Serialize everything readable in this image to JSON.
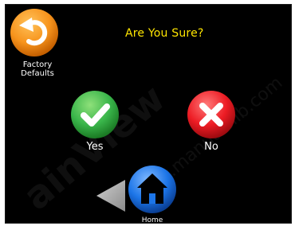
{
  "screen": {
    "title": "Are You Sure?"
  },
  "buttons": {
    "factory_defaults": {
      "label": "Factory Defaults",
      "icon": "undo-arrow-icon",
      "color": "#f7941d"
    },
    "yes": {
      "label": "Yes",
      "icon": "checkmark-icon",
      "color": "#39b54a"
    },
    "no": {
      "label": "No",
      "icon": "x-icon",
      "color": "#ed1c24"
    },
    "back": {
      "icon": "back-triangle-icon",
      "color": "#a6a6a6"
    },
    "home": {
      "label": "Home",
      "icon": "house-icon",
      "color": "#1c75e8"
    }
  },
  "colors": {
    "background": "#000000",
    "title": "#ffe600",
    "label": "#ffffff"
  }
}
